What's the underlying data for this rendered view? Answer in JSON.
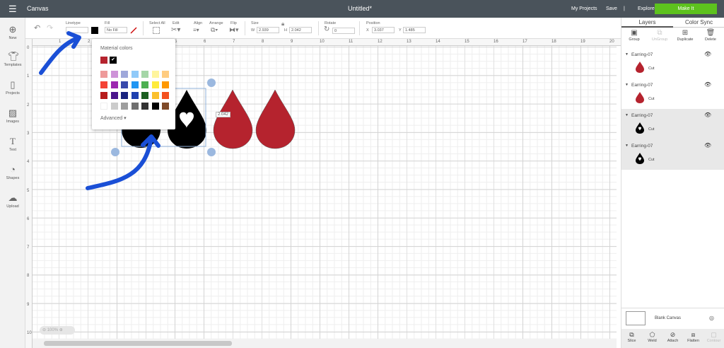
{
  "topbar": {
    "app": "Canvas",
    "title": "Untitled*",
    "my_projects": "My Projects",
    "save": "Save",
    "divider": "|",
    "explore": "Explore",
    "make_it": "Make It"
  },
  "toolbar": {
    "linetype": "Linetype",
    "fill": "Fill",
    "fill_value": "No Fill",
    "select_all": "Select All",
    "edit": "Edit",
    "align": "Align",
    "arrange": "Arrange",
    "flip": "Flip",
    "size": "Size",
    "w_label": "W",
    "w": "2.939",
    "h_label": "H",
    "h": "2.042",
    "rotate": "Rotate",
    "rotate_value": "0",
    "position": "Position",
    "x_label": "X",
    "x": "3.037",
    "y_label": "Y",
    "y": "1.485",
    "color_swatch": "#000000"
  },
  "sidebar": {
    "items": [
      {
        "label": "New",
        "icon": "plus-circle-icon"
      },
      {
        "label": "Templates",
        "icon": "shirt-icon"
      },
      {
        "label": "Projects",
        "icon": "projects-icon"
      },
      {
        "label": "Images",
        "icon": "image-icon"
      },
      {
        "label": "Text",
        "icon": "text-icon"
      },
      {
        "label": "Shapes",
        "icon": "shapes-icon"
      },
      {
        "label": "Upload",
        "icon": "upload-icon"
      }
    ]
  },
  "ruler": {
    "top": [
      "0",
      "1",
      "2",
      "3",
      "4",
      "5",
      "6",
      "7",
      "8",
      "9",
      "10",
      "11",
      "12",
      "13",
      "14",
      "15",
      "16",
      "17",
      "18",
      "19",
      "20"
    ],
    "left": [
      "0",
      "1",
      "2",
      "3",
      "4",
      "5",
      "6",
      "7",
      "8",
      "9",
      "10"
    ]
  },
  "canvas": {
    "dimension_tooltip": "2.042",
    "zoom": "100%"
  },
  "color_popup": {
    "title": "Material colors",
    "recent": [
      "#b5232e",
      "#000000"
    ],
    "rows": [
      [
        "#ee9a9a",
        "#ce93d8",
        "#9fa8da",
        "#90caf9",
        "#a5d6a7",
        "#fff59d",
        "#ffcc80"
      ],
      [
        "#f44336",
        "#9c27b0",
        "#3949ab",
        "#2196f3",
        "#4caf50",
        "#ffeb3b",
        "#ff9800"
      ],
      [
        "#b71c1c",
        "#4a148c",
        "#1a237e",
        "#1e40af",
        "#1b5e20",
        "#fbc02d",
        "#f4511e"
      ],
      [
        "#ffffff",
        "#cccccc",
        "#9e9e9e",
        "#707070",
        "#333333",
        "#000000",
        "#7f4a28"
      ]
    ],
    "advanced": "Advanced"
  },
  "layers_panel": {
    "tabs": [
      "Layers",
      "Color Sync"
    ],
    "tools": [
      "Group",
      "UnGroup",
      "Duplicate",
      "Delete"
    ],
    "layers": [
      {
        "name": "Earring-07",
        "op": "Cut",
        "color": "#b5232e",
        "style": "solid"
      },
      {
        "name": "Earring-07",
        "op": "Cut",
        "color": "#b5232e",
        "style": "solid"
      },
      {
        "name": "Earring-07",
        "op": "Cut",
        "color": "#000000",
        "style": "heart"
      },
      {
        "name": "Earring-07",
        "op": "Cut",
        "color": "#000000",
        "style": "heart"
      }
    ],
    "blank_canvas": "Blank Canvas",
    "bottom_tools": [
      "Slice",
      "Weld",
      "Attach",
      "Flatten",
      "Contour"
    ]
  },
  "colors": {
    "topbar": "#4a535b",
    "make_it": "#5dc21e",
    "accent": "#1a4fd6",
    "drop_red": "#b5232e"
  }
}
